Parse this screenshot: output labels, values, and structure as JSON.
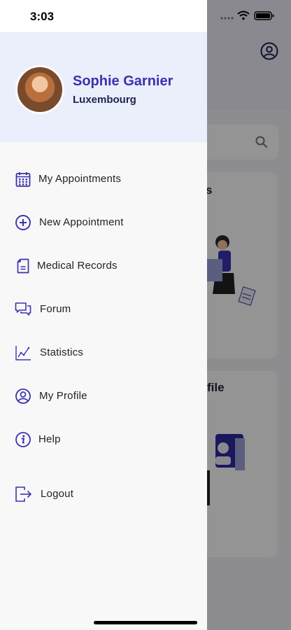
{
  "status_bar": {
    "time": "3:03"
  },
  "user": {
    "name": "Sophie Garnier",
    "location": "Luxembourg"
  },
  "menu": [
    {
      "label": "My Appointments",
      "icon": "calendar-icon"
    },
    {
      "label": "New Appointment",
      "icon": "plus-circle-icon"
    },
    {
      "label": "Medical Records",
      "icon": "document-icon"
    },
    {
      "label": "Forum",
      "icon": "chat-bubbles-icon"
    },
    {
      "label": "Statistics",
      "icon": "chart-line-icon"
    },
    {
      "label": "My Profile",
      "icon": "user-circle-icon"
    },
    {
      "label": "Help",
      "icon": "info-circle-icon"
    },
    {
      "label": "Logout",
      "icon": "logout-icon"
    }
  ],
  "background": {
    "card1_title_fragment": "s",
    "card2_title_fragment": "file"
  },
  "colors": {
    "accent": "#3a32b0",
    "drawer_header": "#ebeefb",
    "drawer_bg": "#f8f8f9"
  }
}
